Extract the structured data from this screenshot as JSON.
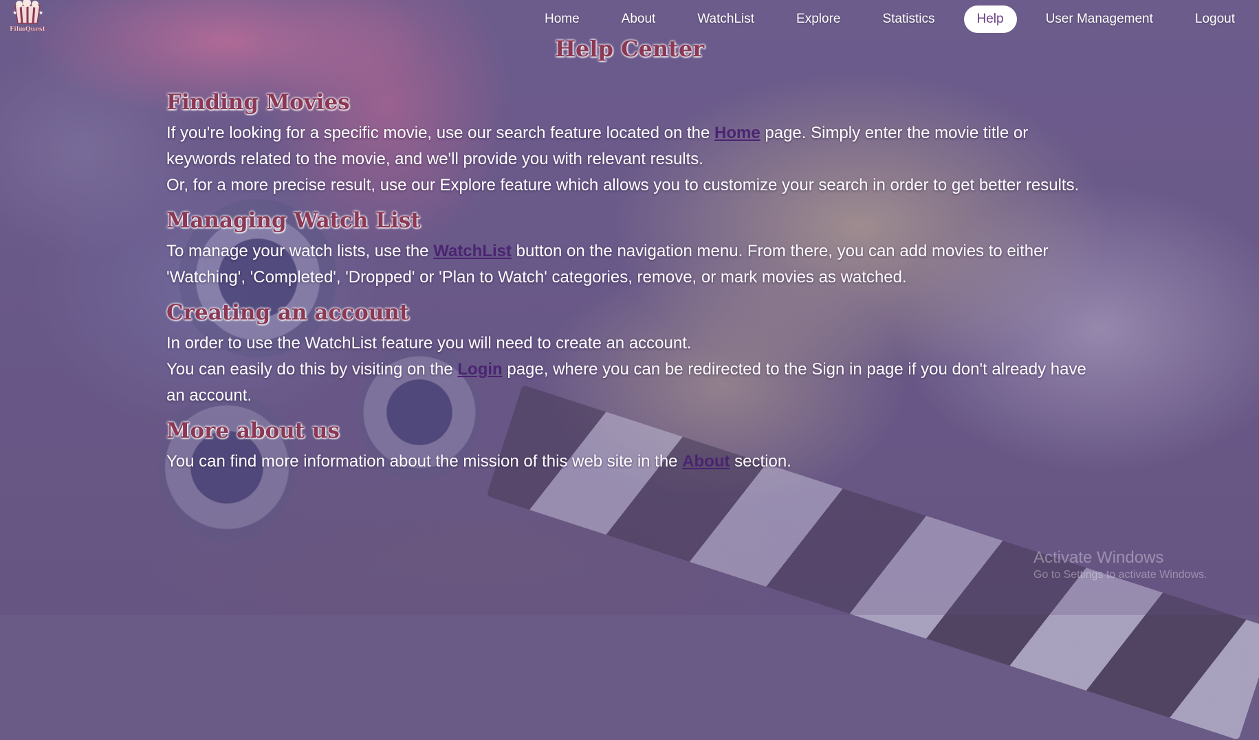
{
  "brand": {
    "logo_text": "FilmQuest"
  },
  "nav": {
    "items": [
      {
        "label": "Home"
      },
      {
        "label": "About"
      },
      {
        "label": "WatchList"
      },
      {
        "label": "Explore"
      },
      {
        "label": "Statistics"
      },
      {
        "label": "Help"
      },
      {
        "label": "User Management"
      },
      {
        "label": "Logout"
      }
    ],
    "active": "Help"
  },
  "page": {
    "title": "Help Center",
    "sections": [
      {
        "heading": "Finding Movies",
        "p1_pre": "If you're looking for a specific movie, use our search feature located on the ",
        "p1_link": "Home",
        "p1_post": " page. Simply enter the movie title or keywords related to the movie, and we'll provide you with relevant results.",
        "p2": "Or, for a more precise result, use our Explore feature which allows you to customize your search in order to get better results."
      },
      {
        "heading": "Managing Watch List",
        "p1_pre": "To manage your watch lists, use the ",
        "p1_link": "WatchList",
        "p1_post": " button on the navigation menu. From there, you can add movies to either 'Watching', 'Completed', 'Dropped' or 'Plan to Watch' categories, remove, or mark movies as watched."
      },
      {
        "heading": "Creating an account",
        "p1": "In order to use the WatchList feature you will need to create an account.",
        "p2_pre": "You can easily do this by visiting on the ",
        "p2_link": "Login",
        "p2_post": " page, where you can be redirected to the Sign in page if you don't already have an account."
      },
      {
        "heading": "More about us",
        "p1_pre": "You can find more information about the mission of this web site in the ",
        "p1_link": "About",
        "p1_post": " section."
      }
    ]
  },
  "watermark": {
    "line1": "Activate Windows",
    "line2": "Go to Settings to activate Windows."
  },
  "colors": {
    "heading": "#8b3855",
    "link": "#4a2470",
    "overlay": "#6a5b88",
    "active_nav_bg": "#ffffff"
  }
}
